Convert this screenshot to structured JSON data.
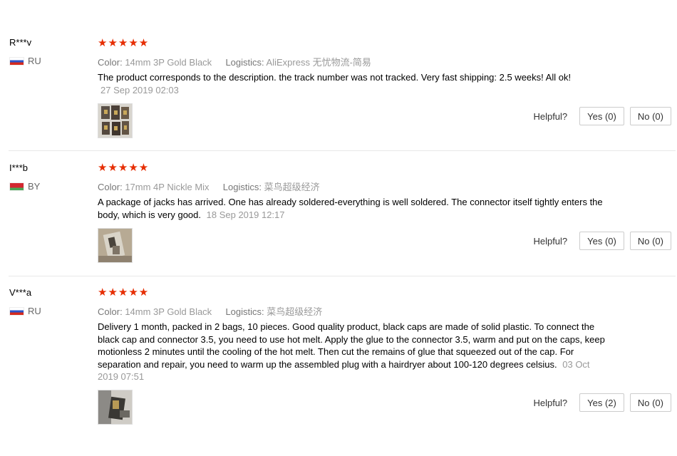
{
  "reviews": [
    {
      "user": "R***v",
      "country": "RU",
      "rating": 5,
      "stars": "★★★★★",
      "color_label": "Color:",
      "color_value": "14mm 3P Gold Black",
      "logistics_label": "Logistics:",
      "logistics_value": "AliExpress 无忧物流-简易",
      "text": "The product corresponds to the description. the track number was not tracked. Very fast shipping: 2.5 weeks! All ok!",
      "date": "27 Sep 2019 02:03",
      "helpful_label": "Helpful?",
      "yes_label": "Yes (0)",
      "no_label": "No (0)"
    },
    {
      "user": "I***b",
      "country": "BY",
      "rating": 5,
      "stars": "★★★★★",
      "color_label": "Color:",
      "color_value": "17mm 4P Nickle Mix",
      "logistics_label": "Logistics:",
      "logistics_value": "菜鸟超级经济",
      "text": "A package of jacks has arrived. One has already soldered-everything is well soldered. The connector itself tightly enters the body, which is very good.",
      "date": "18 Sep 2019 12:17",
      "helpful_label": "Helpful?",
      "yes_label": "Yes (0)",
      "no_label": "No (0)"
    },
    {
      "user": "V***a",
      "country": "RU",
      "rating": 5,
      "stars": "★★★★★",
      "color_label": "Color:",
      "color_value": "14mm 3P Gold Black",
      "logistics_label": "Logistics:",
      "logistics_value": "菜鸟超级经济",
      "text": "Delivery 1 month, packed in 2 bags, 10 pieces. Good quality product, black caps are made of solid plastic. To connect the black cap and connector 3.5, you need to use hot melt. Apply the glue to the connector 3.5, warm and put on the caps, keep motionless 2 minutes until the cooling of the hot melt. Then cut the remains of glue that squeezed out of the cap. For separation and repair, you need to warm up the assembled plug with a hairdryer about 100-120 degrees celsius.",
      "date": "03 Oct 2019 07:51",
      "helpful_label": "Helpful?",
      "yes_label": "Yes (2)",
      "no_label": "No (0)"
    }
  ],
  "colors": {
    "star": "#e62e04",
    "muted": "#999999",
    "border": "#cccccc"
  }
}
